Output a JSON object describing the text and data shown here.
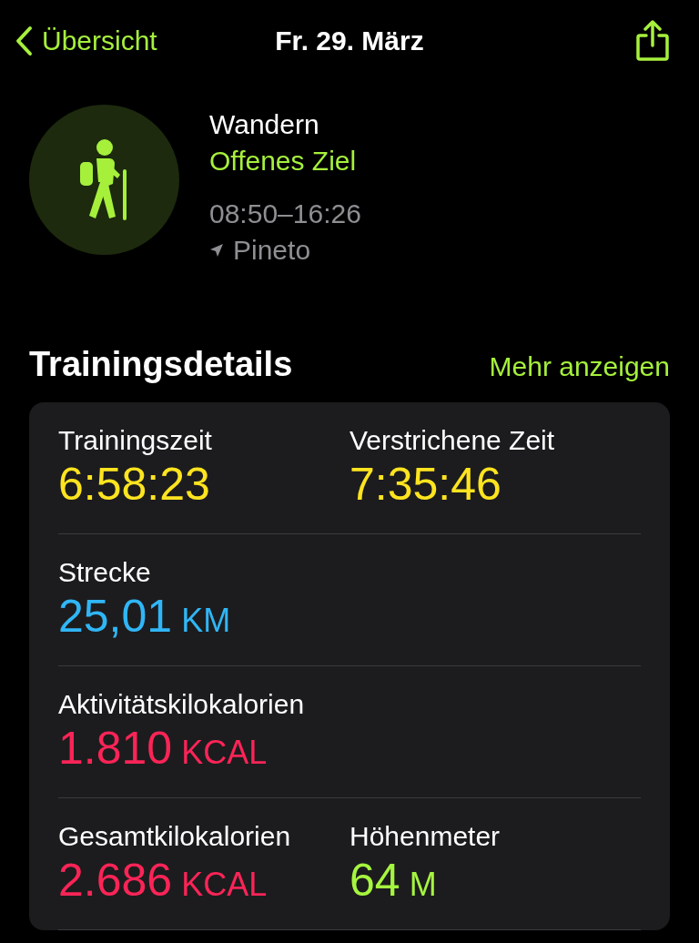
{
  "nav": {
    "back_label": "Übersicht",
    "title": "Fr. 29. März"
  },
  "workout": {
    "type": "Wandern",
    "goal": "Offenes Ziel",
    "time_range": "08:50–16:26",
    "location": "Pineto"
  },
  "section": {
    "title": "Trainingsdetails",
    "link": "Mehr anzeigen"
  },
  "metric_rows": [
    [
      {
        "label": "Trainingszeit",
        "value": "6:58:23",
        "color": "#ffe41f"
      },
      {
        "label": "Verstrichene Zeit",
        "value": "7:35:46",
        "color": "#ffe41f"
      }
    ],
    [
      {
        "label": "Strecke",
        "value": "25,01",
        "unit": "KM",
        "color": "#30b6f6"
      }
    ],
    [
      {
        "label": "Aktivitätskilokalorien",
        "value": "1.810",
        "unit": "KCAL",
        "color": "#fb2457"
      }
    ],
    [
      {
        "label": "Gesamtkilokalorien",
        "value": "2.686",
        "unit": "KCAL",
        "color": "#fb2457"
      },
      {
        "label": "Höhenmeter",
        "value": "64",
        "unit": "M",
        "color": "#a6f53f"
      }
    ]
  ]
}
